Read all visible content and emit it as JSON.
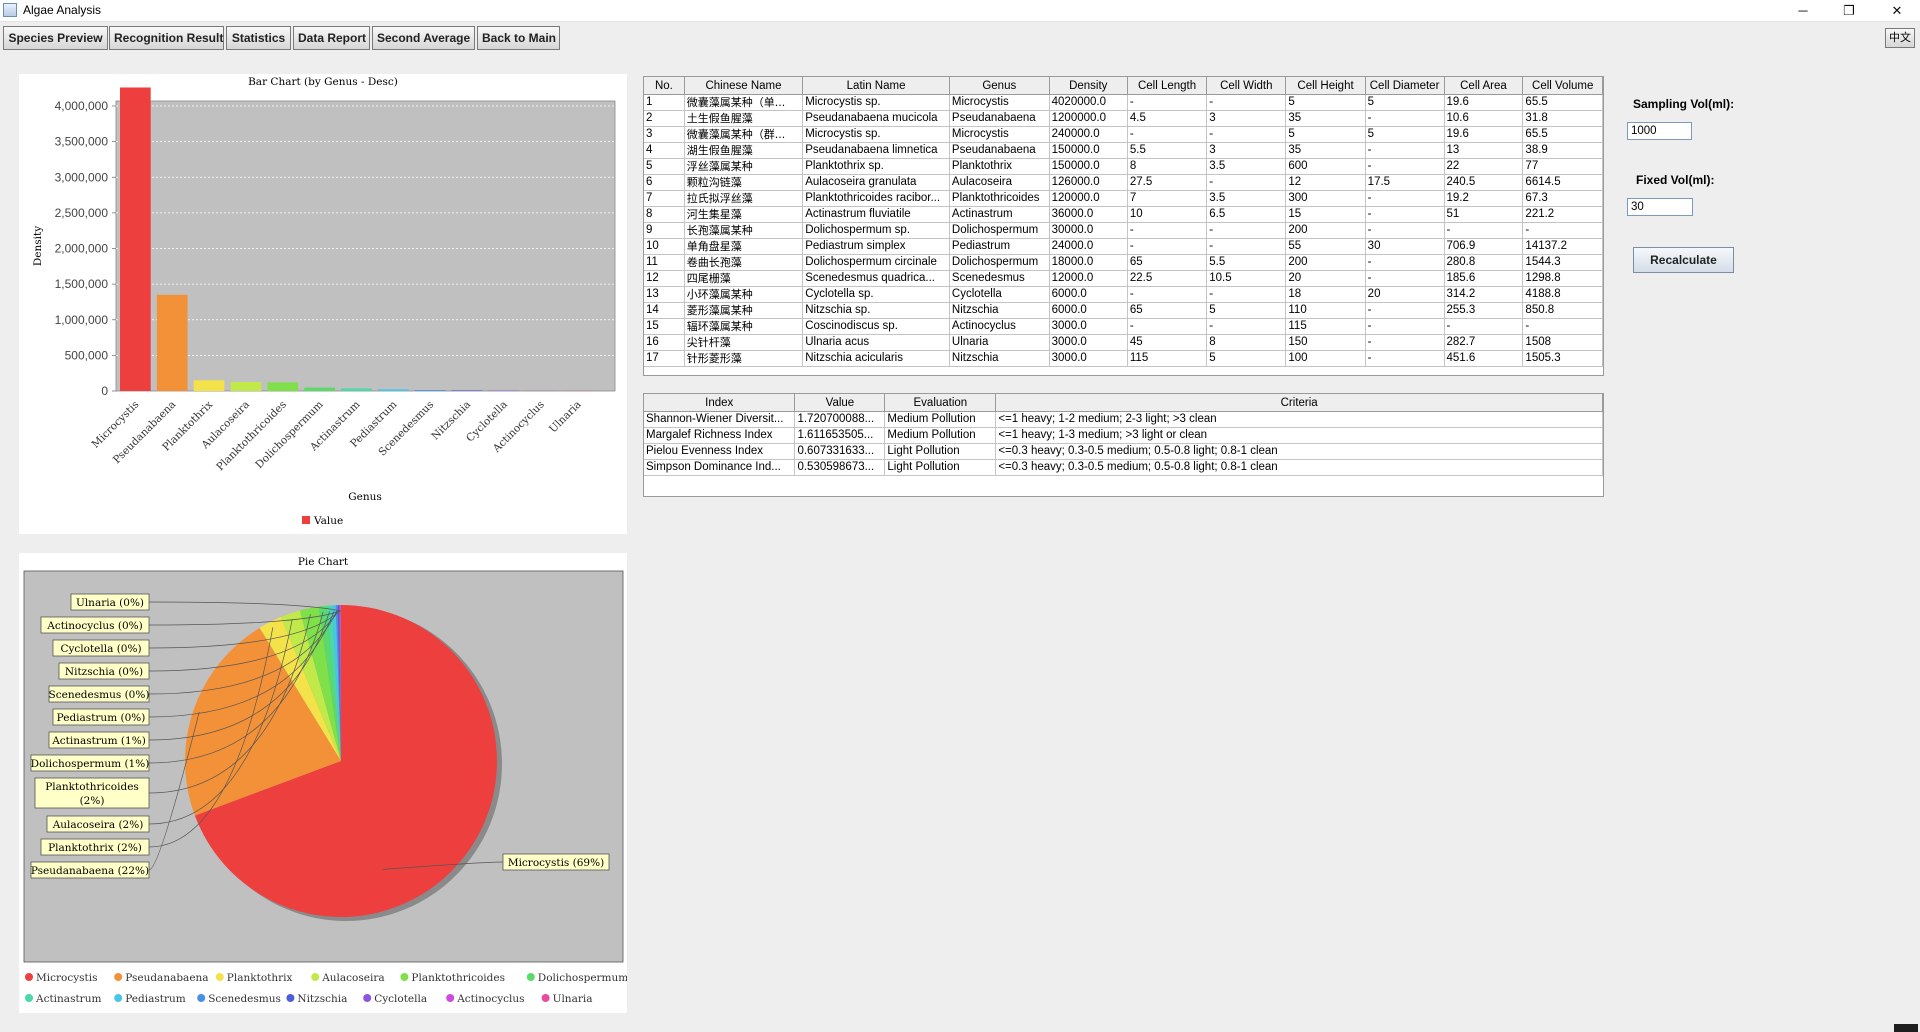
{
  "window": {
    "title": "Algae Analysis",
    "minimize_glyph": "─",
    "maximize_glyph": "❐",
    "close_glyph": "✕"
  },
  "toolbar": {
    "buttons": [
      "Species Preview",
      "Recognition Result",
      "Statistics",
      "Data Report",
      "Second Average",
      "Back to Main"
    ],
    "language_button": "中文"
  },
  "bar_chart": {
    "title": "Bar Chart (by Genus - Desc)",
    "xlabel": "Genus",
    "ylabel": "Density",
    "legend": "Value",
    "ytick_labels": [
      "4,000,000",
      "3,500,000",
      "3,000,000",
      "2,500,000",
      "2,000,000",
      "1,500,000",
      "1,000,000",
      "500,000",
      "0"
    ]
  },
  "pie_chart": {
    "title": "Pie Chart",
    "labels": [
      "Microcystis (69%)",
      "Pseudanabaena (22%)",
      "Planktothrix (2%)",
      "Aulacoseira (2%)",
      "Planktothricoides (2%)",
      "Dolichospermum (1%)",
      "Actinastrum (1%)",
      "Pediastrum (0%)",
      "Scenedesmus (0%)",
      "Nitzschia (0%)",
      "Cyclotella (0%)",
      "Actinocyclus (0%)",
      "Ulnaria (0%)"
    ]
  },
  "chart_data": [
    {
      "type": "bar",
      "title": "Bar Chart (by Genus - Desc)",
      "xlabel": "Genus",
      "ylabel": "Density",
      "ylim": [
        0,
        4500000
      ],
      "categories": [
        "Microcystis",
        "Pseudanabaena",
        "Planktothrix",
        "Aulacoseira",
        "Planktothricoides",
        "Dolichospermum",
        "Actinastrum",
        "Pediastrum",
        "Scenedesmus",
        "Nitzschia",
        "Cyclotella",
        "Actinocyclus",
        "Ulnaria"
      ],
      "values": [
        4260000,
        1350000,
        150000,
        126000,
        120000,
        48000,
        36000,
        24000,
        12000,
        9000,
        6000,
        3000,
        3000
      ],
      "colors": [
        "#ee3f3f",
        "#f39138",
        "#f4e24a",
        "#c2e94a",
        "#7fe04a",
        "#5bd96b",
        "#4ad9a6",
        "#49c6e4",
        "#4a8fe6",
        "#4f5ed8",
        "#8a56e0",
        "#d04ae0",
        "#e84a9c"
      ],
      "legend": [
        "Value"
      ],
      "grid": true,
      "legend_position": "bottom"
    },
    {
      "type": "pie",
      "title": "Pie Chart",
      "categories": [
        "Microcystis",
        "Pseudanabaena",
        "Planktothrix",
        "Aulacoseira",
        "Planktothricoides",
        "Dolichospermum",
        "Actinastrum",
        "Pediastrum",
        "Scenedesmus",
        "Nitzschia",
        "Cyclotella",
        "Actinocyclus",
        "Ulnaria"
      ],
      "values": [
        4260000,
        1350000,
        150000,
        126000,
        120000,
        48000,
        36000,
        24000,
        12000,
        9000,
        6000,
        3000,
        3000
      ],
      "percent_labels": [
        "69%",
        "22%",
        "2%",
        "2%",
        "2%",
        "1%",
        "1%",
        "0%",
        "0%",
        "0%",
        "0%",
        "0%",
        "0%"
      ],
      "colors": [
        "#ee3f3f",
        "#f39138",
        "#f4e24a",
        "#c2e94a",
        "#7fe04a",
        "#5bd96b",
        "#4ad9a6",
        "#49c6e4",
        "#4a8fe6",
        "#4f5ed8",
        "#8a56e0",
        "#d04ae0",
        "#e84a9c"
      ],
      "legend_position": "bottom"
    }
  ],
  "species_table": {
    "headers": [
      "No.",
      "Chinese Name",
      "Latin Name",
      "Genus",
      "Density",
      "Cell Length",
      "Cell Width",
      "Cell Height",
      "Cell Diameter",
      "Cell Area",
      "Cell Volume"
    ],
    "rows": [
      [
        "1",
        "微囊藻属某种（单...",
        "Microcystis sp.",
        "Microcystis",
        "4020000.0",
        "-",
        "-",
        "5",
        "5",
        "19.6",
        "65.5"
      ],
      [
        "2",
        "土生假鱼腥藻",
        "Pseudanabaena mucicola",
        "Pseudanabaena",
        "1200000.0",
        "4.5",
        "3",
        "35",
        "-",
        "10.6",
        "31.8"
      ],
      [
        "3",
        "微囊藻属某种（群...",
        "Microcystis sp.",
        "Microcystis",
        "240000.0",
        "-",
        "-",
        "5",
        "5",
        "19.6",
        "65.5"
      ],
      [
        "4",
        "湖生假鱼腥藻",
        "Pseudanabaena limnetica",
        "Pseudanabaena",
        "150000.0",
        "5.5",
        "3",
        "35",
        "-",
        "13",
        "38.9"
      ],
      [
        "5",
        "浮丝藻属某种",
        "Planktothrix sp.",
        "Planktothrix",
        "150000.0",
        "8",
        "3.5",
        "600",
        "-",
        "22",
        "77"
      ],
      [
        "6",
        "颗粒沟链藻",
        "Aulacoseira granulata",
        "Aulacoseira",
        "126000.0",
        "27.5",
        "-",
        "12",
        "17.5",
        "240.5",
        "6614.5"
      ],
      [
        "7",
        "拉氏拟浮丝藻",
        "Planktothricoides racibor...",
        "Planktothricoides",
        "120000.0",
        "7",
        "3.5",
        "300",
        "-",
        "19.2",
        "67.3"
      ],
      [
        "8",
        "河生集星藻",
        "Actinastrum fluviatile",
        "Actinastrum",
        "36000.0",
        "10",
        "6.5",
        "15",
        "-",
        "51",
        "221.2"
      ],
      [
        "9",
        "长孢藻属某种",
        "Dolichospermum sp.",
        "Dolichospermum",
        "30000.0",
        "-",
        "-",
        "200",
        "-",
        "-",
        "-"
      ],
      [
        "10",
        "单角盘星藻",
        "Pediastrum simplex",
        "Pediastrum",
        "24000.0",
        "-",
        "-",
        "55",
        "30",
        "706.9",
        "14137.2"
      ],
      [
        "11",
        "卷曲长孢藻",
        "Dolichospermum circinale",
        "Dolichospermum",
        "18000.0",
        "65",
        "5.5",
        "200",
        "-",
        "280.8",
        "1544.3"
      ],
      [
        "12",
        "四尾栅藻",
        "Scenedesmus quadrica...",
        "Scenedesmus",
        "12000.0",
        "22.5",
        "10.5",
        "20",
        "-",
        "185.6",
        "1298.8"
      ],
      [
        "13",
        "小环藻属某种",
        "Cyclotella sp.",
        "Cyclotella",
        "6000.0",
        "-",
        "-",
        "18",
        "20",
        "314.2",
        "4188.8"
      ],
      [
        "14",
        "菱形藻属某种",
        "Nitzschia sp.",
        "Nitzschia",
        "6000.0",
        "65",
        "5",
        "110",
        "-",
        "255.3",
        "850.8"
      ],
      [
        "15",
        "辐环藻属某种",
        "Coscinodiscus sp.",
        "Actinocyclus",
        "3000.0",
        "-",
        "-",
        "115",
        "-",
        "-",
        "-"
      ],
      [
        "16",
        "尖针杆藻",
        "Ulnaria acus",
        "Ulnaria",
        "3000.0",
        "45",
        "8",
        "150",
        "-",
        "282.7",
        "1508"
      ],
      [
        "17",
        "针形菱形藻",
        "Nitzschia acicularis",
        "Nitzschia",
        "3000.0",
        "115",
        "5",
        "100",
        "-",
        "451.6",
        "1505.3"
      ]
    ]
  },
  "index_table": {
    "headers": [
      "Index",
      "Value",
      "Evaluation",
      "Criteria"
    ],
    "rows": [
      [
        "Shannon-Wiener Diversit...",
        "1.720700088...",
        "Medium Pollution",
        "<=1 heavy; 1-2 medium; 2-3 light; >3 clean"
      ],
      [
        "Margalef Richness Index",
        "1.611653505...",
        "Medium Pollution",
        "<=1 heavy; 1-3 medium; >3 light or clean"
      ],
      [
        "Pielou Evenness Index",
        "0.607331633...",
        "Light Pollution",
        "<=0.3 heavy; 0.3-0.5 medium; 0.5-0.8 light; 0.8-1 clean"
      ],
      [
        "Simpson Dominance Ind...",
        "0.530598673...",
        "Light Pollution",
        "<=0.3 heavy; 0.3-0.5 medium; 0.5-0.8 light; 0.8-1 clean"
      ]
    ]
  },
  "controls": {
    "sampling_label": "Sampling Vol(ml):",
    "sampling_value": "1000",
    "fixed_label": "Fixed Vol(ml):",
    "fixed_value": "30",
    "recalculate_label": "Recalculate"
  }
}
